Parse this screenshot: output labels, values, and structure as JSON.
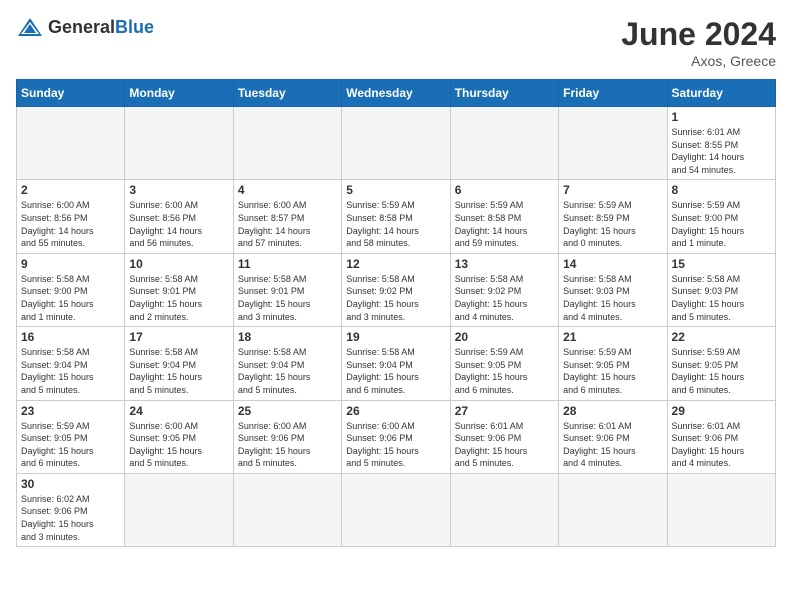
{
  "header": {
    "logo_general": "General",
    "logo_blue": "Blue",
    "title": "June 2024",
    "subtitle": "Axos, Greece"
  },
  "weekdays": [
    "Sunday",
    "Monday",
    "Tuesday",
    "Wednesday",
    "Thursday",
    "Friday",
    "Saturday"
  ],
  "weeks": [
    [
      {
        "day": "",
        "info": ""
      },
      {
        "day": "",
        "info": ""
      },
      {
        "day": "",
        "info": ""
      },
      {
        "day": "",
        "info": ""
      },
      {
        "day": "",
        "info": ""
      },
      {
        "day": "",
        "info": ""
      },
      {
        "day": "1",
        "info": "Sunrise: 6:01 AM\nSunset: 8:55 PM\nDaylight: 14 hours\nand 54 minutes."
      }
    ],
    [
      {
        "day": "2",
        "info": "Sunrise: 6:00 AM\nSunset: 8:56 PM\nDaylight: 14 hours\nand 55 minutes."
      },
      {
        "day": "3",
        "info": "Sunrise: 6:00 AM\nSunset: 8:56 PM\nDaylight: 14 hours\nand 56 minutes."
      },
      {
        "day": "4",
        "info": "Sunrise: 6:00 AM\nSunset: 8:57 PM\nDaylight: 14 hours\nand 57 minutes."
      },
      {
        "day": "5",
        "info": "Sunrise: 5:59 AM\nSunset: 8:58 PM\nDaylight: 14 hours\nand 58 minutes."
      },
      {
        "day": "6",
        "info": "Sunrise: 5:59 AM\nSunset: 8:58 PM\nDaylight: 14 hours\nand 59 minutes."
      },
      {
        "day": "7",
        "info": "Sunrise: 5:59 AM\nSunset: 8:59 PM\nDaylight: 15 hours\nand 0 minutes."
      },
      {
        "day": "8",
        "info": "Sunrise: 5:59 AM\nSunset: 9:00 PM\nDaylight: 15 hours\nand 1 minute."
      }
    ],
    [
      {
        "day": "9",
        "info": "Sunrise: 5:58 AM\nSunset: 9:00 PM\nDaylight: 15 hours\nand 1 minute."
      },
      {
        "day": "10",
        "info": "Sunrise: 5:58 AM\nSunset: 9:01 PM\nDaylight: 15 hours\nand 2 minutes."
      },
      {
        "day": "11",
        "info": "Sunrise: 5:58 AM\nSunset: 9:01 PM\nDaylight: 15 hours\nand 3 minutes."
      },
      {
        "day": "12",
        "info": "Sunrise: 5:58 AM\nSunset: 9:02 PM\nDaylight: 15 hours\nand 3 minutes."
      },
      {
        "day": "13",
        "info": "Sunrise: 5:58 AM\nSunset: 9:02 PM\nDaylight: 15 hours\nand 4 minutes."
      },
      {
        "day": "14",
        "info": "Sunrise: 5:58 AM\nSunset: 9:03 PM\nDaylight: 15 hours\nand 4 minutes."
      },
      {
        "day": "15",
        "info": "Sunrise: 5:58 AM\nSunset: 9:03 PM\nDaylight: 15 hours\nand 5 minutes."
      }
    ],
    [
      {
        "day": "16",
        "info": "Sunrise: 5:58 AM\nSunset: 9:04 PM\nDaylight: 15 hours\nand 5 minutes."
      },
      {
        "day": "17",
        "info": "Sunrise: 5:58 AM\nSunset: 9:04 PM\nDaylight: 15 hours\nand 5 minutes."
      },
      {
        "day": "18",
        "info": "Sunrise: 5:58 AM\nSunset: 9:04 PM\nDaylight: 15 hours\nand 5 minutes."
      },
      {
        "day": "19",
        "info": "Sunrise: 5:58 AM\nSunset: 9:04 PM\nDaylight: 15 hours\nand 6 minutes."
      },
      {
        "day": "20",
        "info": "Sunrise: 5:59 AM\nSunset: 9:05 PM\nDaylight: 15 hours\nand 6 minutes."
      },
      {
        "day": "21",
        "info": "Sunrise: 5:59 AM\nSunset: 9:05 PM\nDaylight: 15 hours\nand 6 minutes."
      },
      {
        "day": "22",
        "info": "Sunrise: 5:59 AM\nSunset: 9:05 PM\nDaylight: 15 hours\nand 6 minutes."
      }
    ],
    [
      {
        "day": "23",
        "info": "Sunrise: 5:59 AM\nSunset: 9:05 PM\nDaylight: 15 hours\nand 6 minutes."
      },
      {
        "day": "24",
        "info": "Sunrise: 6:00 AM\nSunset: 9:05 PM\nDaylight: 15 hours\nand 5 minutes."
      },
      {
        "day": "25",
        "info": "Sunrise: 6:00 AM\nSunset: 9:06 PM\nDaylight: 15 hours\nand 5 minutes."
      },
      {
        "day": "26",
        "info": "Sunrise: 6:00 AM\nSunset: 9:06 PM\nDaylight: 15 hours\nand 5 minutes."
      },
      {
        "day": "27",
        "info": "Sunrise: 6:01 AM\nSunset: 9:06 PM\nDaylight: 15 hours\nand 5 minutes."
      },
      {
        "day": "28",
        "info": "Sunrise: 6:01 AM\nSunset: 9:06 PM\nDaylight: 15 hours\nand 4 minutes."
      },
      {
        "day": "29",
        "info": "Sunrise: 6:01 AM\nSunset: 9:06 PM\nDaylight: 15 hours\nand 4 minutes."
      }
    ],
    [
      {
        "day": "30",
        "info": "Sunrise: 6:02 AM\nSunset: 9:06 PM\nDaylight: 15 hours\nand 3 minutes."
      },
      {
        "day": "",
        "info": ""
      },
      {
        "day": "",
        "info": ""
      },
      {
        "day": "",
        "info": ""
      },
      {
        "day": "",
        "info": ""
      },
      {
        "day": "",
        "info": ""
      },
      {
        "day": "",
        "info": ""
      }
    ]
  ]
}
